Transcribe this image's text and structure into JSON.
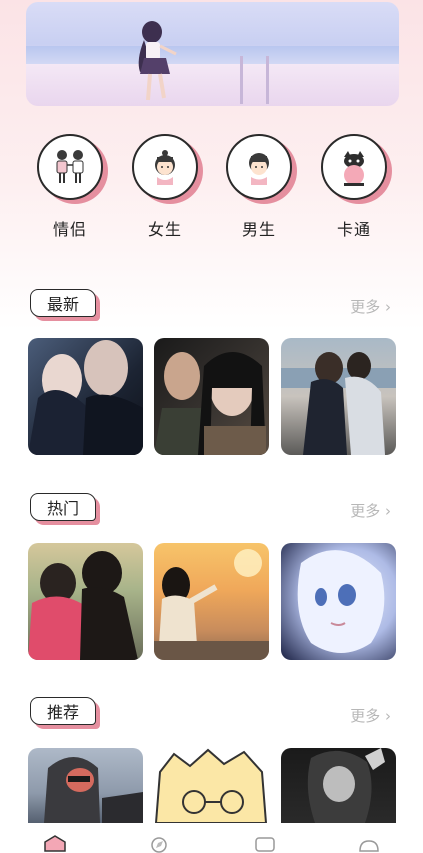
{
  "categories": [
    {
      "label": "情侣",
      "icon": "couple-icon"
    },
    {
      "label": "女生",
      "icon": "girl-icon"
    },
    {
      "label": "男生",
      "icon": "boy-icon"
    },
    {
      "label": "卡通",
      "icon": "cartoon-cat-icon"
    }
  ],
  "sections": [
    {
      "title": "最新",
      "more": "更多 ›"
    },
    {
      "title": "热门",
      "more": "更多 ›"
    },
    {
      "title": "推荐",
      "more": "更多 ›"
    }
  ],
  "colors": {
    "accent": "#e58f9f",
    "outline": "#2a2a2a",
    "more_text": "#b7b7b7"
  },
  "nav": [
    "home-icon",
    "discover-icon",
    "category-icon",
    "profile-icon"
  ]
}
